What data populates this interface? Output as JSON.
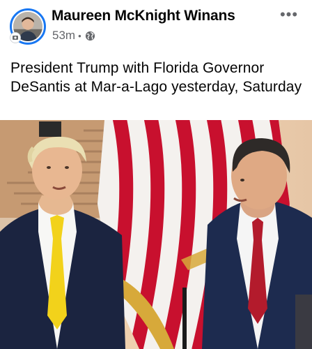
{
  "post": {
    "author": "Maureen McKnight Winans",
    "timestamp": "53m",
    "separator": "•",
    "privacy_icon": "globe-icon",
    "more_icon": "more-options-icon",
    "more_label": "•••",
    "text": "President Trump with Florida Governor DeSantis at Mar-a-Lago yesterday, Saturday",
    "photo_icon": "post-photo"
  },
  "colors": {
    "avatar_ring": "#1877f2",
    "meta_text": "#65676b",
    "flag_red": "#c8102e",
    "tie_yellow": "#f2d21b",
    "tie_red": "#b31b2c",
    "suit_navy": "#1b2440"
  }
}
